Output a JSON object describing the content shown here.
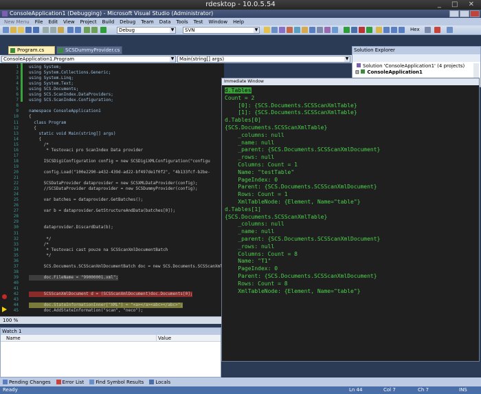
{
  "rdesktop": {
    "title": "rdesktop - 10.0.5.54"
  },
  "window": {
    "title": "ConsoleApplication1 (Debugging) - Microsoft Visual Studio (Administrator)"
  },
  "menu": [
    "New Menu",
    "File",
    "Edit",
    "View",
    "Project",
    "Build",
    "Debug",
    "Team",
    "Data",
    "Tools",
    "Test",
    "Window",
    "Help"
  ],
  "toolbar": {
    "config": "Debug",
    "platform": "SVN",
    "hex_label": "Hex"
  },
  "tabs": [
    {
      "label": "Program.cs",
      "active": true
    },
    {
      "label": "SCSDummyProvider.cs",
      "active": false
    }
  ],
  "nav": {
    "class_combo": "ConsoleApplication1.Program",
    "member_combo": "Main(string[] args)"
  },
  "code": {
    "line_numbers": [
      "1",
      "2",
      "3",
      "4",
      "5",
      "6",
      "7",
      "8",
      "9",
      "10",
      "11",
      "12",
      "13",
      "14",
      "15",
      "16",
      "17",
      "18",
      "19",
      "20",
      "21",
      "22",
      "23",
      "24",
      "25",
      "26",
      "27",
      "28",
      "29",
      "30",
      "31",
      "32",
      "33",
      "34",
      "35",
      "36",
      "37",
      "38",
      "39",
      "40",
      "41",
      "42",
      "43",
      "44",
      "45"
    ],
    "lines": [
      "using System;",
      "using System.Collections.Generic;",
      "using System.Linq;",
      "using System.Text;",
      "using SCS.Documents;",
      "using SCS.ScanIndex.DataProviders;",
      "using SCS.ScanIndex.Configuration;",
      "",
      "namespace ConsoleApplication1",
      "{",
      "  class Program",
      "  {",
      "    static void Main(string[] args)",
      "    {",
      "      /*",
      "       * Testovaci pro ScanIndex Data provider",
      "",
      "      ISCSDigiConfiguration config = new SCSDigiXMLConfiguration(\"configu",
      "",
      "      config.Load(\"100e2290-a432-439d-ad22-bf497de1f0f2\", \"4b133fcf-b2be-",
      "",
      "      SCSDataProvider dataprovider = new SCSXMLDataProvider(config);",
      "      //SCSDataProvider dataprovider = new SCSDummyProvider(config);",
      "",
      "      var batches = dataprovider.GetBatches();",
      "",
      "      var b = dataprovider.GetStructureAndData(batches[0]);",
      "",
      "",
      "      dataprovider.DiscardData(b);",
      "",
      "       */",
      "      /*",
      "       * Testovaci cast pouze na SCSScanXmlDocumentBatch",
      "       */",
      "",
      "      SCS.Documents.SCSScanXmlDocumentBatch doc = new SCS.Documents.SCSScanXml",
      "",
      "      doc.FileName = \"99000001.xml\";",
      "",
      "",
      "      SCSScanXmlDocument d = (SCSScanXmlDocument)doc.Documents[0];",
      "",
      "      doc.StateInformationInner[\"XML\"] = \"<a></a><abc></abc>\";",
      "      doc.AddStateInformation(\"scan\", \"neco\");"
    ]
  },
  "zoom": "100 %",
  "immediate": {
    "title": "Immediate Window",
    "lines": [
      "d.Tables",
      "Count = 2",
      "    [0]: {SCS.Documents.SCSScanXmlTable}",
      "    [1]: {SCS.Documents.SCSScanXmlTable}",
      "d.Tables[0]",
      "{SCS.Documents.SCSScanXmlTable}",
      "    _columns: null",
      "    _name: null",
      "    _parent: {SCS.Documents.SCSScanXmlDocument}",
      "    _rows: null",
      "    Columns: Count = 1",
      "    Name: \"testTable\"",
      "    PageIndex: 0",
      "    Parent: {SCS.Documents.SCSScanXmlDocument}",
      "    Rows: Count = 1",
      "    XmlTableNode: {Element, Name=\"table\"}",
      "d.Tables[1]",
      "{SCS.Documents.SCSScanXmlTable}",
      "    _columns: null",
      "    _name: null",
      "    _parent: {SCS.Documents.SCSScanXmlDocument}",
      "    _rows: null",
      "    Columns: Count = 8",
      "    Name: \"T1\"",
      "    PageIndex: 0",
      "    Parent: {SCS.Documents.SCSScanXmlDocument}",
      "    Rows: Count = 8",
      "    XmlTableNode: {Element, Name=\"table\"}"
    ]
  },
  "solution_explorer": {
    "title": "Solution Explorer",
    "solution": "Solution 'ConsoleApplication1' (4 projects)",
    "project": "ConsoleApplication1"
  },
  "watch": {
    "title": "Watch 1",
    "col_name": "Name",
    "col_value": "Value"
  },
  "bottom_tabs": [
    "Pending Changes",
    "Error List",
    "Find Symbol Results",
    "Locals"
  ],
  "status": {
    "left": "Ready",
    "ln": "Ln 44",
    "col": "Col 7",
    "ch": "Ch 7",
    "mode": "INS"
  }
}
